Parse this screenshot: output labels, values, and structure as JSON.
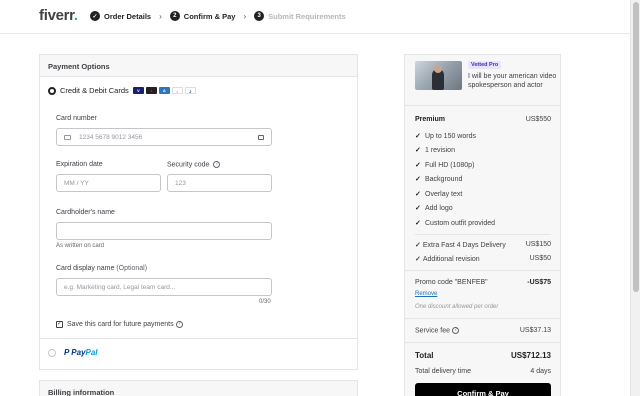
{
  "header": {
    "logo": "fiverr",
    "logo_dot": ".",
    "steps": [
      {
        "num": "✓",
        "label": "Order Details"
      },
      {
        "num": "2",
        "label": "Confirm & Pay"
      },
      {
        "num": "3",
        "label": "Submit Requirements"
      }
    ]
  },
  "payment": {
    "title": "Payment Options",
    "card_method_label": "Credit & Debit Cards",
    "card_number_label": "Card number",
    "card_number_placeholder": "1234 5678 9012 3456",
    "expiration_label": "Expiration date",
    "expiration_placeholder": "MM / YY",
    "security_label": "Security code",
    "security_placeholder": "123",
    "holder_label": "Cardholder's name",
    "holder_hint": "As written on card",
    "display_label": "Card display name",
    "display_optional": "(Optional)",
    "display_placeholder": "e.g. Marketing card, Legal team card...",
    "display_counter": "0/30",
    "save_label": "Save this card for future payments",
    "paypal_label": "PayPal",
    "paypal_pay": "Pay",
    "paypal_pal": "Pal"
  },
  "billing": {
    "title": "Billing information"
  },
  "summary": {
    "badge": "Vetted Pro",
    "gig_title": "I will be your american video spokesperson and actor",
    "package_name": "Premium",
    "package_price": "US$550",
    "features": [
      "Up to 150 words",
      "1 revision",
      "Full HD (1080p)",
      "Background",
      "Overlay text",
      "Add logo",
      "Custom outfit provided"
    ],
    "extras": [
      {
        "label": "Extra Fast 4 Days Delivery",
        "price": "US$150"
      },
      {
        "label": "Additional revision",
        "price": "US$50"
      }
    ],
    "promo_label": "Promo code \"BENFEB\"",
    "promo_value": "-US$75",
    "promo_remove": "Remove",
    "promo_note": "One discount allowed per order",
    "service_fee_label": "Service fee",
    "service_fee_value": "US$37.13",
    "total_label": "Total",
    "total_value": "US$712.13",
    "delivery_label": "Total delivery time",
    "delivery_value": "4 days",
    "pay_button": "Confirm & Pay"
  },
  "colors": {
    "brand": "#1dbf73",
    "button": "#000000",
    "link": "#1d6fb8",
    "badge_bg": "#e8e4ff"
  }
}
